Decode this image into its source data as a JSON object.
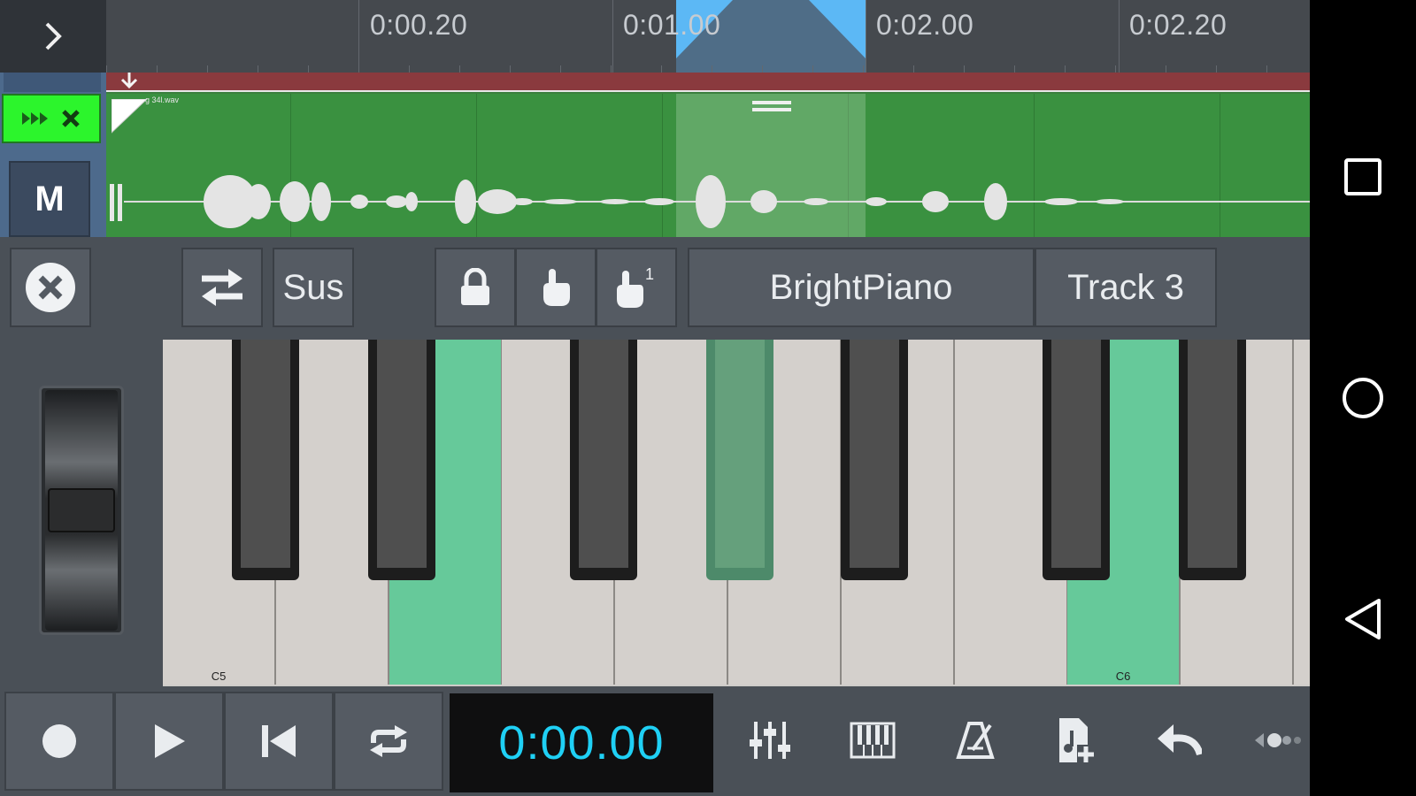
{
  "timeline": {
    "expand_icon": "chevron-right-icon",
    "markers": [
      "0:00.20",
      "0:01.00",
      "0:02.00",
      "0:02.20"
    ]
  },
  "track": {
    "mute_label": "M",
    "clip_name": "g 34l.wav",
    "active_color": "#2cf52c"
  },
  "toolbar": {
    "close_icon": "close-circle-icon",
    "swap_icon": "swap-arrows-icon",
    "sustain_label": "Sus",
    "lock_icon": "lock-icon",
    "touch_icon": "hand-pointer-icon",
    "touch_one_icon": "hand-pointer-one-icon",
    "instrument": "BrightPiano",
    "track_name": "Track 3"
  },
  "keyboard": {
    "white_keys": [
      {
        "label": "C5",
        "active": false
      },
      {
        "label": "",
        "active": false
      },
      {
        "label": "",
        "active": true
      },
      {
        "label": "",
        "active": false
      },
      {
        "label": "",
        "active": false
      },
      {
        "label": "",
        "active": false
      },
      {
        "label": "",
        "active": false
      },
      {
        "label": "",
        "active": false
      },
      {
        "label": "C6",
        "active": true
      },
      {
        "label": "",
        "active": false
      },
      {
        "label": "",
        "active": false
      },
      {
        "label": "",
        "active": false
      }
    ],
    "black_keys_active": [
      false,
      false,
      false,
      true,
      false,
      false,
      false
    ],
    "highlight_color": "#66c99a"
  },
  "transport": {
    "time": "0:00.00",
    "record_icon": "record-icon",
    "play_icon": "play-icon",
    "rewind_icon": "skip-back-icon",
    "loop_icon": "loop-icon",
    "mixer_icon": "mixer-sliders-icon",
    "piano_icon": "piano-icon",
    "metronome_icon": "metronome-icon",
    "add_file_icon": "add-file-icon",
    "undo_icon": "undo-icon",
    "more_icon": "more-icon",
    "time_color": "#1fd0f5"
  },
  "system_nav": {
    "recents_icon": "square-icon",
    "home_icon": "circle-icon",
    "back_icon": "triangle-back-icon"
  }
}
